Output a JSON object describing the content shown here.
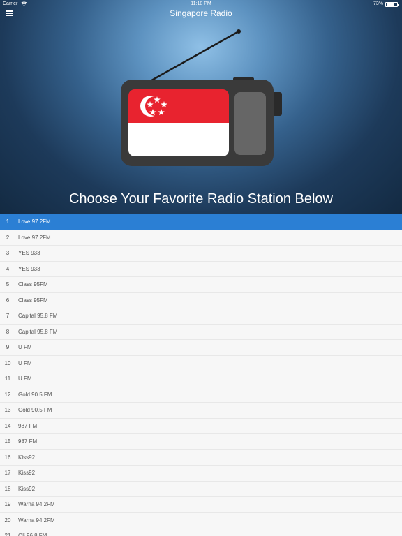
{
  "status_bar": {
    "carrier": "Carrier",
    "time": "11:18 PM",
    "battery": "73%"
  },
  "nav": {
    "title": "Singapore Radio",
    "menu_icon": "hamburger-menu-icon"
  },
  "hero": {
    "heading": "Choose Your Favorite Radio Station Below",
    "illustration": "radio-with-singapore-flag"
  },
  "colors": {
    "accent": "#2b7fd4",
    "flag_red": "#e8232f",
    "radio_body": "#3a3a3a"
  },
  "stations": [
    {
      "num": "1",
      "name": "Love 97.2FM",
      "selected": true
    },
    {
      "num": "2",
      "name": "Love 97.2FM"
    },
    {
      "num": "3",
      "name": "YES 933"
    },
    {
      "num": "4",
      "name": "YES 933"
    },
    {
      "num": "5",
      "name": "Class 95FM"
    },
    {
      "num": "6",
      "name": "Class 95FM"
    },
    {
      "num": "7",
      "name": "Capital 95.8 FM"
    },
    {
      "num": "8",
      "name": "Capital 95.8 FM"
    },
    {
      "num": "9",
      "name": "U FM"
    },
    {
      "num": "10",
      "name": "U FM"
    },
    {
      "num": "11",
      "name": "U FM"
    },
    {
      "num": "12",
      "name": "Gold 90.5 FM"
    },
    {
      "num": "13",
      "name": "Gold 90.5 FM"
    },
    {
      "num": "14",
      "name": "987 FM"
    },
    {
      "num": "15",
      "name": "987 FM"
    },
    {
      "num": "16",
      "name": "Kiss92"
    },
    {
      "num": "17",
      "name": "Kiss92"
    },
    {
      "num": "18",
      "name": "Kiss92"
    },
    {
      "num": "19",
      "name": "Warna 94.2FM"
    },
    {
      "num": "20",
      "name": "Warna 94.2FM"
    },
    {
      "num": "21",
      "name": "Oli 96.8 FM"
    }
  ]
}
